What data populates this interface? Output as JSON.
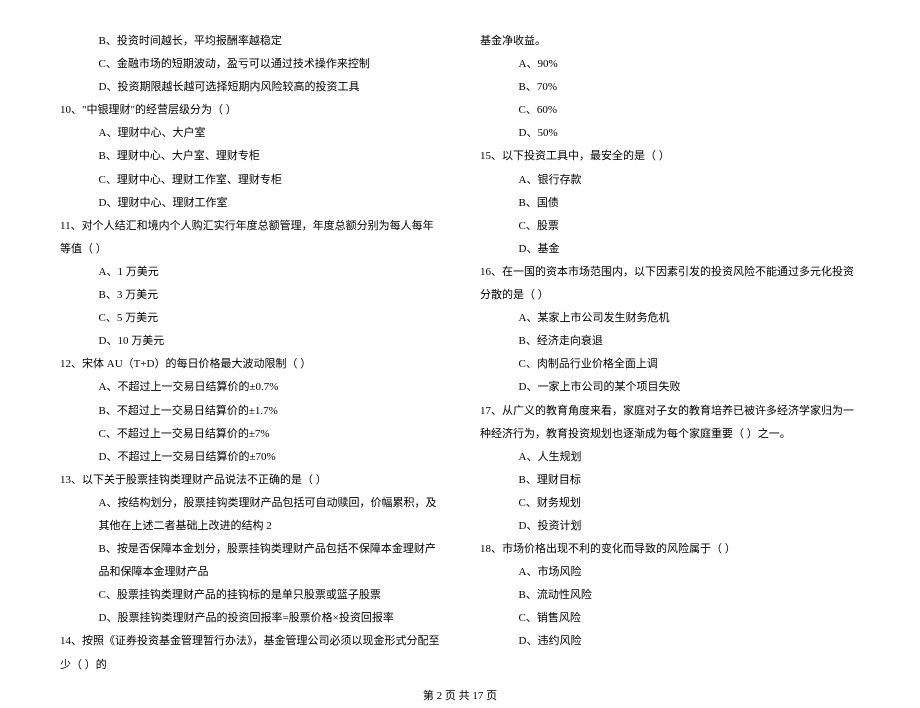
{
  "left": {
    "opt_B_9": "B、投资时间越长，平均报酬率越稳定",
    "opt_C_9": "C、金融市场的短期波动，盈亏可以通过技术操作来控制",
    "opt_D_9": "D、投资期限越长越可选择短期内风险较高的投资工具",
    "q10": "10、\"中银理财\"的经营层级分为（    ）",
    "q10_A": "A、理财中心、大户室",
    "q10_B": "B、理财中心、大户室、理财专柜",
    "q10_C": "C、理财中心、理财工作室、理财专柜",
    "q10_D": "D、理财中心、理财工作室",
    "q11": "11、对个人结汇和境内个人购汇实行年度总额管理，年度总额分别为每人每年等值（    ）",
    "q11_A": "A、1 万美元",
    "q11_B": "B、3 万美元",
    "q11_C": "C、5 万美元",
    "q11_D": "D、10 万美元",
    "q12": "12、宋体 AU（T+D）的每日价格最大波动限制（    ）",
    "q12_A": "A、不超过上一交易日结算价的±0.7%",
    "q12_B": "B、不超过上一交易日结算价的±1.7%",
    "q12_C": "C、不超过上一交易日结算价的±7%",
    "q12_D": "D、不超过上一交易日结算价的±70%",
    "q13": "13、以下关于股票挂钩类理财产品说法不正确的是（    ）",
    "q13_A": "A、按结构划分，股票挂钩类理财产品包括可自动赎回，价幅累积，及其他在上述二者基础上改进的结构 2",
    "q13_B": "B、按是否保障本金划分，股票挂钩类理财产品包括不保障本金理财产品和保障本金理财产品",
    "q13_C": "C、股票挂钩类理财产品的挂钩标的是单只股票或篮子股票",
    "q13_D": "D、股票挂钩类理财产品的投资回报率=股票价格×投资回报率",
    "q14": "14、按照《证券投资基金管理暂行办法》，基金管理公司必须以现金形式分配至少（    ）的"
  },
  "right": {
    "q14_cont": "基金净收益。",
    "q14_A": "A、90%",
    "q14_B": "B、70%",
    "q14_C": "C、60%",
    "q14_D": "D、50%",
    "q15": "15、以下投资工具中，最安全的是（    ）",
    "q15_A": "A、银行存款",
    "q15_B": "B、国债",
    "q15_C": "C、股票",
    "q15_D": "D、基金",
    "q16": "16、在一国的资本市场范围内，以下因素引发的投资风险不能通过多元化投资分散的是（    ）",
    "q16_A": "A、某家上市公司发生财务危机",
    "q16_B": "B、经济走向衰退",
    "q16_C": "C、肉制品行业价格全面上调",
    "q16_D": "D、一家上市公司的某个项目失败",
    "q17": "17、从广义的教育角度来看，家庭对子女的教育培养已被许多经济学家归为一种经济行为，教育投资规划也逐渐成为每个家庭重要（    ）之一。",
    "q17_A": "A、人生规划",
    "q17_B": "B、理财目标",
    "q17_C": "C、财务规划",
    "q17_D": "D、投资计划",
    "q18": "18、市场价格出现不利的变化而导致的风险属于（    ）",
    "q18_A": "A、市场风险",
    "q18_B": "B、流动性风险",
    "q18_C": "C、销售风险",
    "q18_D": "D、违约风险"
  },
  "footer": "第 2 页 共 17 页"
}
